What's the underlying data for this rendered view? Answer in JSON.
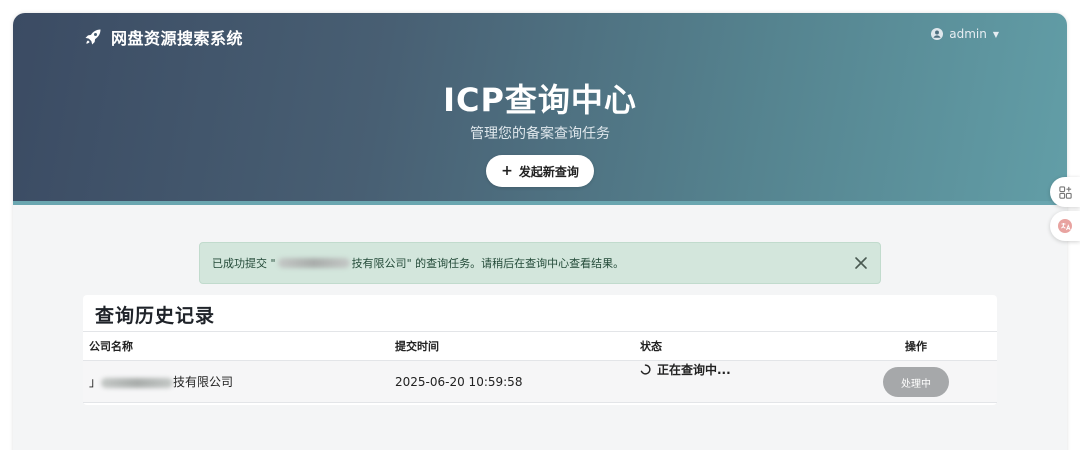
{
  "header": {
    "brand": "网盘资源搜索系统",
    "user": "admin"
  },
  "hero": {
    "title": "ICP查询中心",
    "subtitle": "管理您的备案查询任务",
    "new_query_label": "发起新查询"
  },
  "alert": {
    "prefix": "已成功提交 \"",
    "company_visible": "技有限公司",
    "suffix": "\" 的查询任务。请稍后在查询中心查看结果。"
  },
  "history": {
    "title": "查询历史记录",
    "columns": [
      "公司名称",
      "提交时间",
      "状态",
      "操作"
    ],
    "rows": [
      {
        "company_visible": "技有限公司",
        "submitted": "2025-06-20 10:59:58",
        "status": "正在查询中...",
        "action": "处理中"
      }
    ]
  },
  "icons": [
    "rocket-icon",
    "user-circle-icon",
    "caret-down-icon",
    "plus-icon",
    "close-icon",
    "spinner-icon",
    "grid-plus-icon",
    "translate-icon"
  ],
  "colors": {
    "hero_start": "#3b4b63",
    "hero_end": "#629ea7",
    "alert_bg": "#d3e6dc",
    "button_gray": "#a6a8aa"
  }
}
